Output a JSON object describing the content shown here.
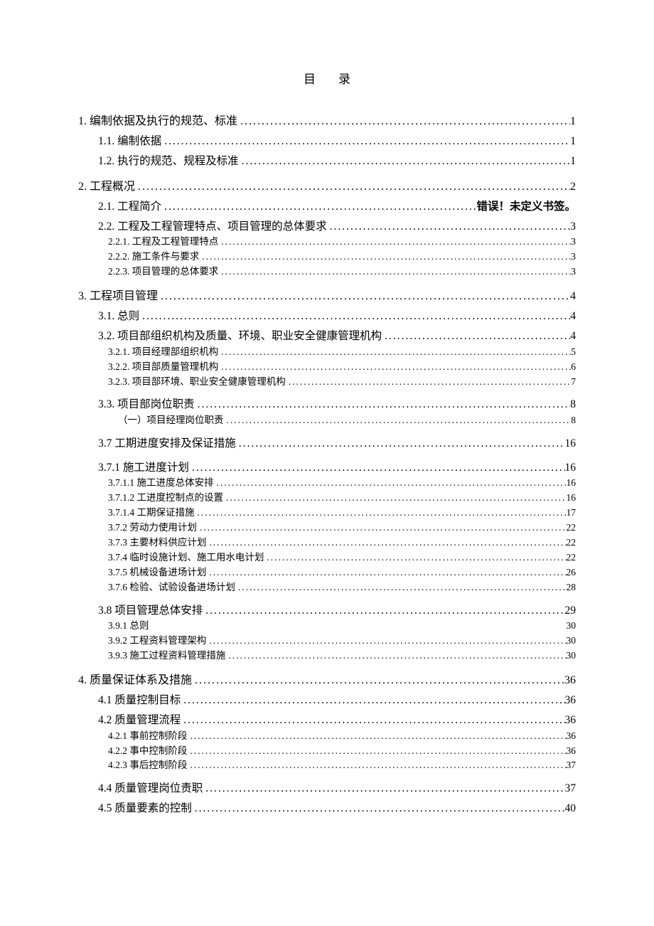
{
  "title": "目录",
  "toc": [
    {
      "num": "1.",
      "text": "编制依据及执行的规范、标准",
      "page": "1",
      "level": 1
    },
    {
      "num": "1.1.",
      "text": "编制依据",
      "page": "1",
      "level": 2
    },
    {
      "num": "1.2.",
      "text": "执行的规范、规程及标准",
      "page": "1",
      "level": 2
    },
    {
      "num": "2.",
      "text": "工程概况",
      "page": "2",
      "level": 1
    },
    {
      "num": "2.1.",
      "text": "工程简介",
      "page": "错误！未定义书签。",
      "level": 2,
      "error": true
    },
    {
      "num": "2.2.",
      "text": "工程及工程管理特点、项目管理的总体要求",
      "page": "3",
      "level": 2
    },
    {
      "num": "2.2.1.",
      "text": "工程及工程管理特点",
      "page": "3",
      "level": 3
    },
    {
      "num": "2.2.2.",
      "text": "施工条件与要求",
      "page": "3",
      "level": 3
    },
    {
      "num": "2.2.3.",
      "text": "项目管理的总体要求",
      "page": "3",
      "level": 3
    },
    {
      "num": "3.",
      "text": "工程项目管理",
      "page": "4",
      "level": 1
    },
    {
      "num": "3.1.",
      "text": "总则",
      "page": "4",
      "level": 2
    },
    {
      "num": "3.2.",
      "text": "项目部组织机构及质量、环境、职业安全健康管理机构",
      "page": "4",
      "level": 2
    },
    {
      "num": "3.2.1.",
      "text": "项目经理部组织机构",
      "page": "5",
      "level": 3
    },
    {
      "num": "3.2.2.",
      "text": "项目部质量管理机构",
      "page": "6",
      "level": 3
    },
    {
      "num": "3.2.3.",
      "text": "项目部环境、职业安全健康管理机构",
      "page": "7",
      "level": 3
    },
    {
      "num": "3.3.",
      "text": "项目部岗位职责",
      "page": "8",
      "level": 2,
      "gap": true
    },
    {
      "num": "",
      "text": "（一）项目经理岗位职责",
      "page": "8",
      "level": 3,
      "sublabel": true
    },
    {
      "num": "3.7",
      "text": "工期进度安排及保证措施",
      "page": "16",
      "level": 2,
      "gap": true
    },
    {
      "num": "3.7.1",
      "text": "施工进度计划",
      "page": "16",
      "level": 2,
      "gap": true
    },
    {
      "num": "3.7.1.1",
      "text": "施工进度总体安排",
      "page": "16",
      "level": 3
    },
    {
      "num": "3.7.1.2",
      "text": "工进度控制点的设置",
      "page": "16",
      "level": 3
    },
    {
      "num": "3.7.1.4",
      "text": "工期保证措施",
      "page": "17",
      "level": 3
    },
    {
      "num": "3.7.2",
      "text": "劳动力使用计划",
      "page": "22",
      "level": 3
    },
    {
      "num": "3.7.3",
      "text": "主要材料供应计划",
      "page": "22",
      "level": 3
    },
    {
      "num": "3.7.4",
      "text": "临时设施计划、施工用水电计划",
      "page": "22",
      "level": 3
    },
    {
      "num": "3.7.5",
      "text": "机械设备进场计划",
      "page": "26",
      "level": 3
    },
    {
      "num": "3.7.6",
      "text": "检验、试验设备进场计划",
      "page": "28",
      "level": 3
    },
    {
      "num": "3.8",
      "text": "项目管理总体安排",
      "page": "29",
      "level": 2,
      "gap": true
    },
    {
      "num": "3.9.1",
      "text": "总则",
      "page": "30",
      "level": 3,
      "noleader": true
    },
    {
      "num": "3.9.2",
      "text": "工程资料管理架构",
      "page": "30",
      "level": 3
    },
    {
      "num": "3.9.3",
      "text": "施工过程资料管理措施",
      "page": "30",
      "level": 3
    },
    {
      "num": "4.",
      "text": "质量保证体系及措施",
      "page": "36",
      "level": 1
    },
    {
      "num": "4.1",
      "text": "质量控制目标",
      "page": "36",
      "level": 2
    },
    {
      "num": "4.2",
      "text": "质量管理流程",
      "page": "36",
      "level": 2
    },
    {
      "num": "4.2.1",
      "text": "事前控制阶段",
      "page": "36",
      "level": 3
    },
    {
      "num": "4.2.2",
      "text": "事中控制阶段",
      "page": "36",
      "level": 3
    },
    {
      "num": "4.2.3",
      "text": "事后控制阶段",
      "page": "37",
      "level": 3
    },
    {
      "num": "4.4",
      "text": "质量管理岗位责职",
      "page": "37",
      "level": 2,
      "gap": true
    },
    {
      "num": "4.5",
      "text": "质量要素的控制",
      "page": "40",
      "level": 2
    }
  ]
}
